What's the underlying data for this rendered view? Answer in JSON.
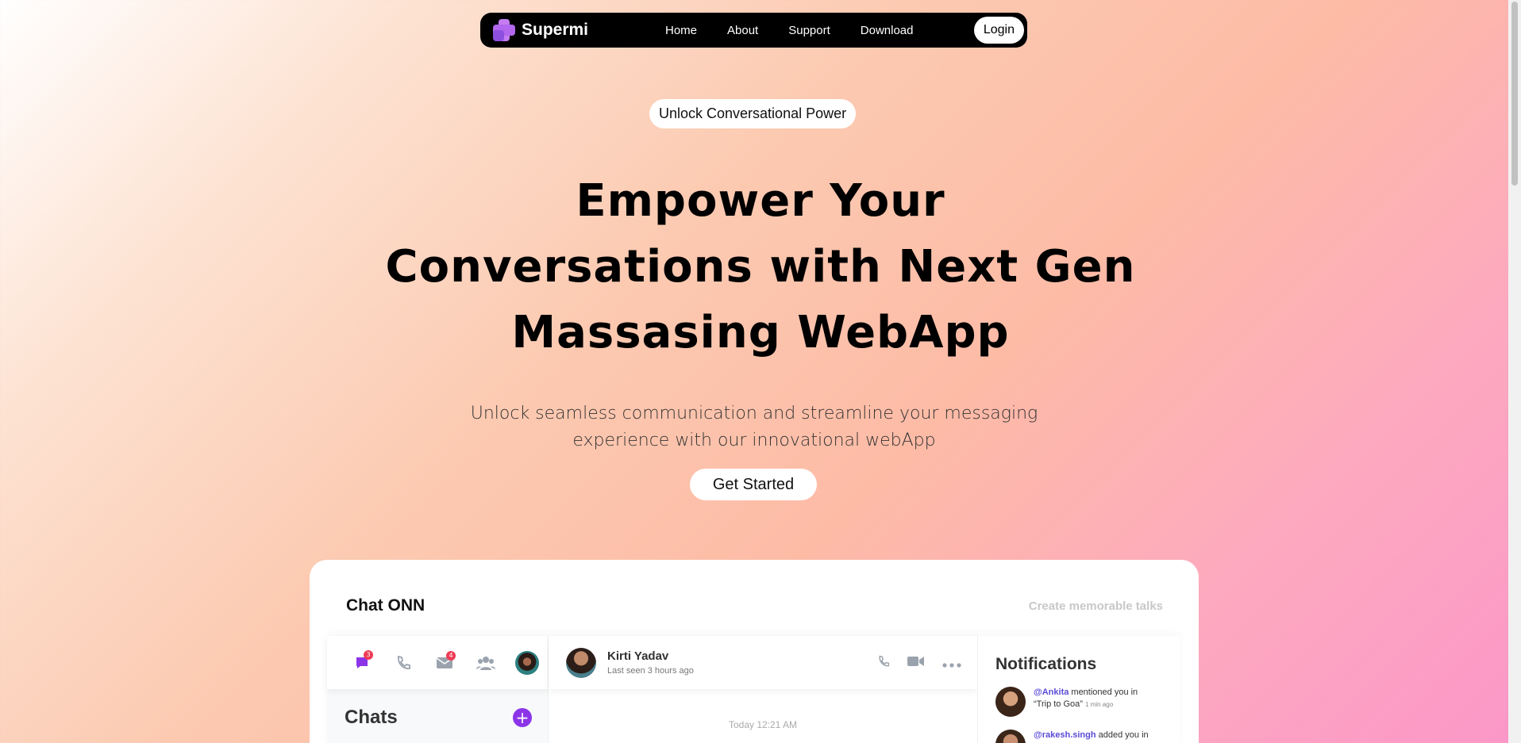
{
  "navbar": {
    "brand": "Supermi",
    "links": [
      "Home",
      "About",
      "Support",
      "Download"
    ],
    "login": "Login"
  },
  "hero": {
    "pill": "Unlock Conversational Power",
    "title_lines": [
      "Empower Your",
      "Conversations with Next Gen",
      "Massasing WebApp"
    ],
    "subtitle_lines": [
      "Unlock seamless communication and streamline your messaging",
      "experience with our innovational webApp"
    ],
    "cta": "Get Started"
  },
  "preview": {
    "title": "Chat ONN",
    "tagline": "Create memorable talks",
    "icons": [
      {
        "name": "chat-icon",
        "badge": "3"
      },
      {
        "name": "phone-icon",
        "badge": ""
      },
      {
        "name": "mail-icon",
        "badge": "4"
      },
      {
        "name": "group-icon",
        "badge": ""
      }
    ],
    "chats_title": "Chats",
    "plus": "+",
    "contact": {
      "name": "Kirti Yadav",
      "status": "Last seen 3 hours ago"
    },
    "date_label": "Today 12:21 AM",
    "notifications_title": "Notifications",
    "notifications": [
      {
        "handle": "@Ankita",
        "text": " mentioned you in",
        "line2": "“Trip to Goa”",
        "time": "1 min ago"
      },
      {
        "handle": "@rakesh.singh",
        "text": " added you in",
        "line2": "",
        "time": ""
      }
    ]
  },
  "colors": {
    "accent": "#8c35e8",
    "badge": "#ef3b55",
    "handle": "#5a4bd6"
  }
}
